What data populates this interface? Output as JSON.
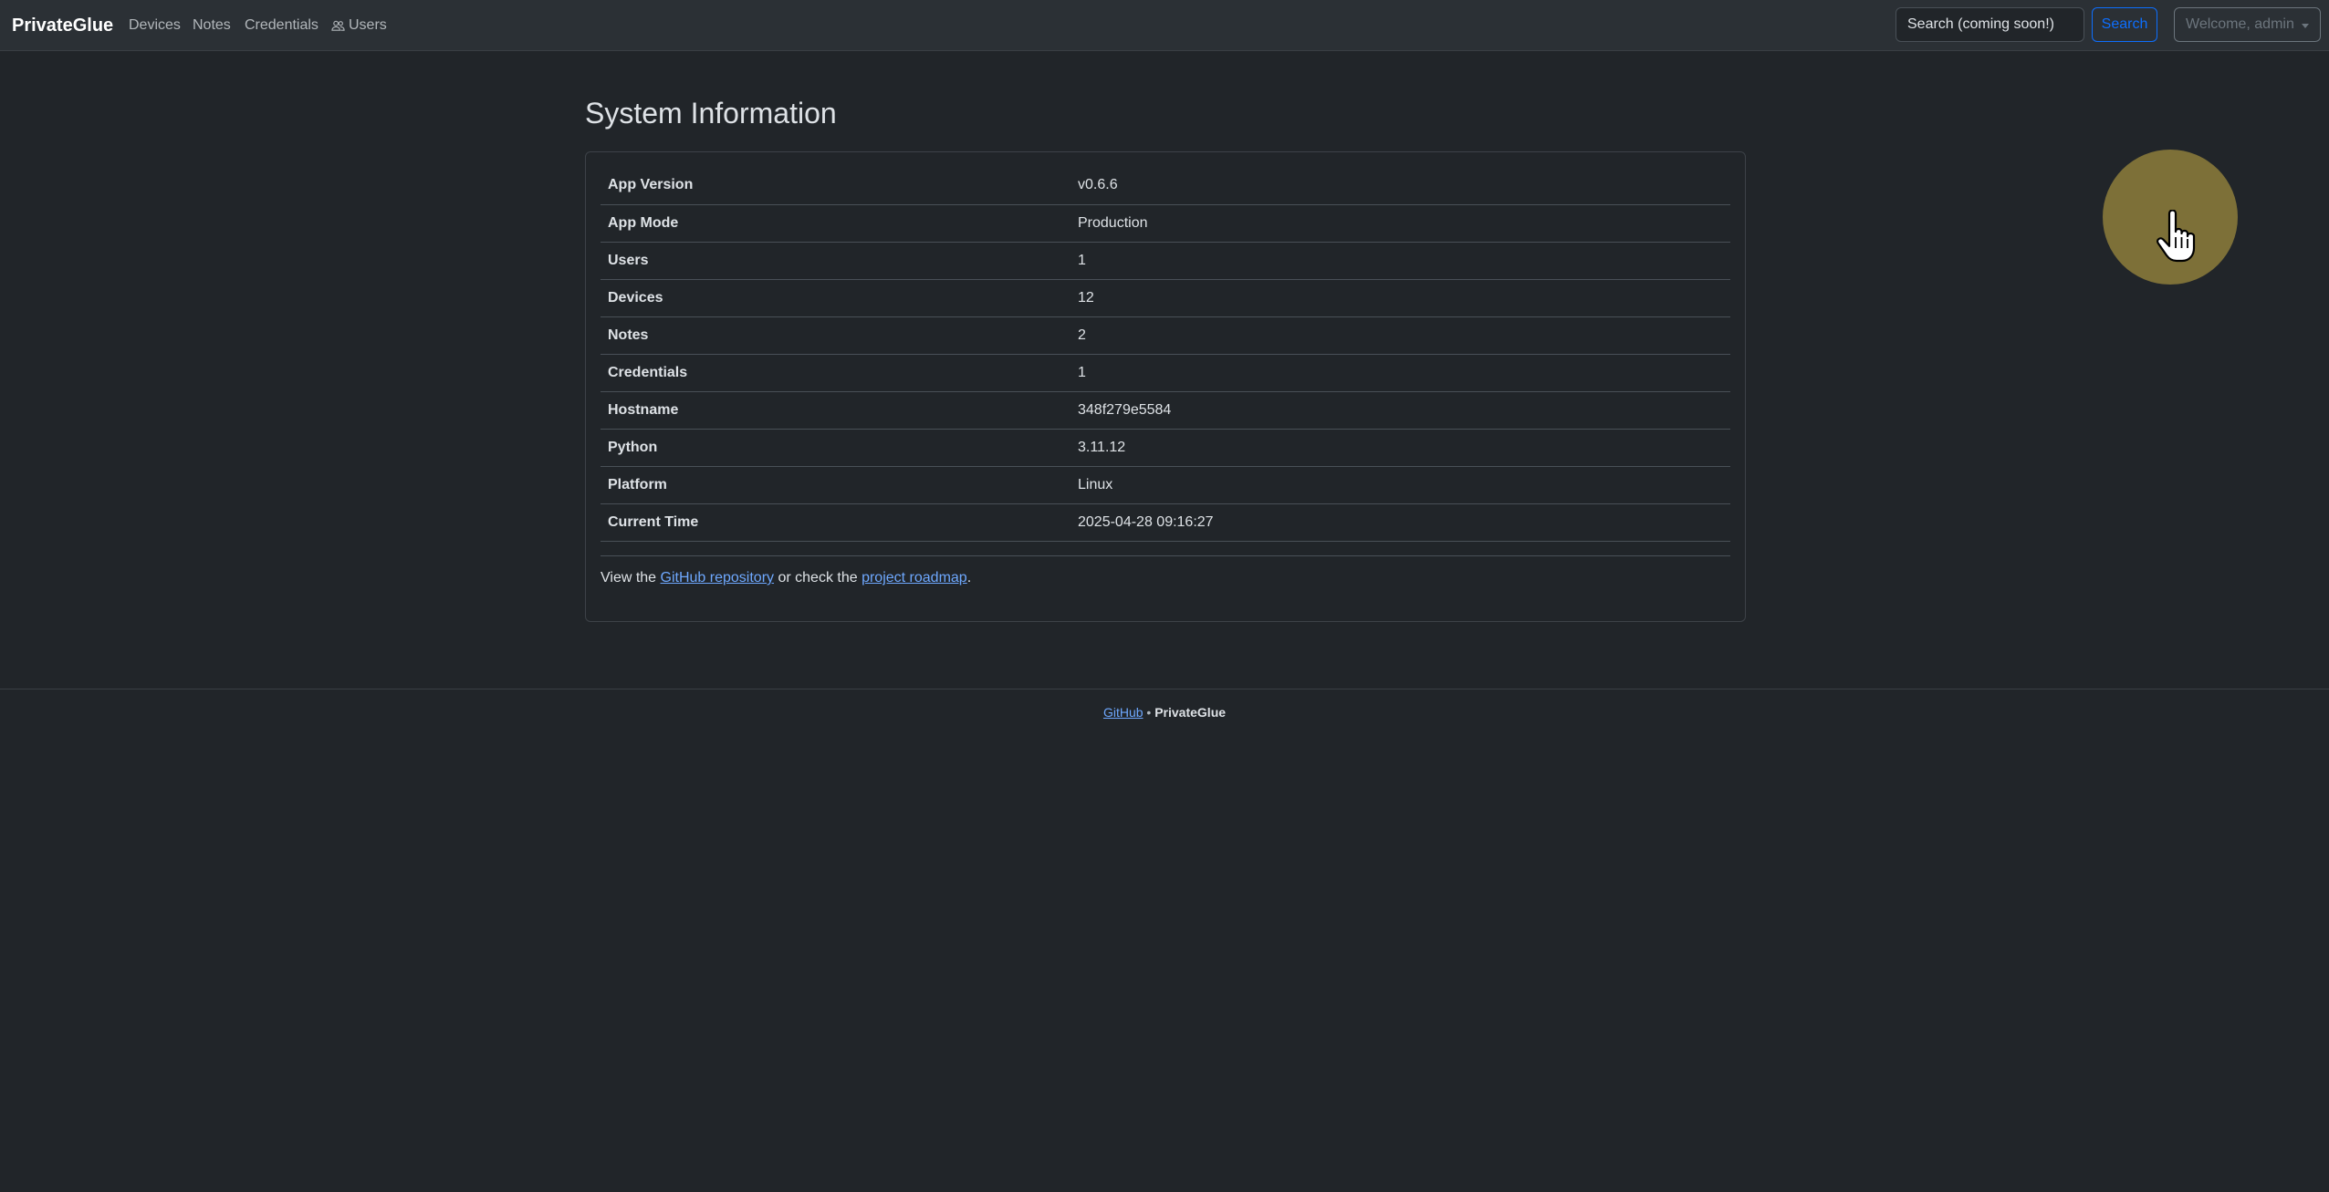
{
  "navbar": {
    "brand": "PrivateGlue",
    "links": [
      {
        "label": "Devices"
      },
      {
        "label": "Notes"
      },
      {
        "label": "Credentials"
      },
      {
        "label": "Users",
        "icon": "people-icon"
      }
    ],
    "search_placeholder": "Search (coming soon!)",
    "search_button": "Search",
    "user_menu": "Welcome, admin"
  },
  "main": {
    "title": "System Information",
    "rows": [
      {
        "key": "App Version",
        "value": "v0.6.6"
      },
      {
        "key": "App Mode",
        "value": "Production"
      },
      {
        "key": "Users",
        "value": "1"
      },
      {
        "key": "Devices",
        "value": "12"
      },
      {
        "key": "Notes",
        "value": "2"
      },
      {
        "key": "Credentials",
        "value": "1"
      },
      {
        "key": "Hostname",
        "value": "348f279e5584"
      },
      {
        "key": "Python",
        "value": "3.11.12"
      },
      {
        "key": "Platform",
        "value": "Linux"
      },
      {
        "key": "Current Time",
        "value": "2025-04-28 09:16:27"
      }
    ],
    "footer_note": {
      "prefix": "View the ",
      "github_link": "GitHub repository",
      "middle": " or check the ",
      "roadmap_link": "project roadmap",
      "suffix": "."
    }
  },
  "footer": {
    "github_link": "GitHub",
    "separator": " • ",
    "brand": "PrivateGlue"
  },
  "colors": {
    "background": "#212529",
    "navbar": "#2b3035",
    "primary": "#0d6efd",
    "link": "#6ea8fe",
    "cursor_highlight": "#7d7038"
  }
}
